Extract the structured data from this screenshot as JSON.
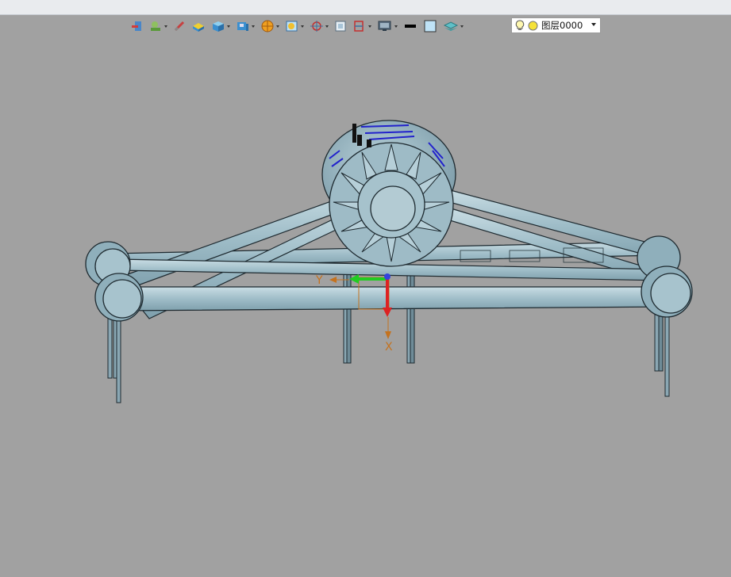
{
  "toolbar": {
    "buttons": [
      {
        "name": "snap-icon",
        "dropdown": false
      },
      {
        "name": "feature-icon",
        "dropdown": true
      },
      {
        "name": "pen-icon",
        "dropdown": false
      },
      {
        "name": "face-icon",
        "dropdown": false
      },
      {
        "name": "solid-icon",
        "dropdown": true
      },
      {
        "name": "view-cube-icon",
        "dropdown": true
      },
      {
        "name": "render-icon",
        "dropdown": true
      },
      {
        "name": "select-filter-icon",
        "dropdown": true
      },
      {
        "name": "target-icon",
        "dropdown": true
      },
      {
        "name": "frame-icon",
        "dropdown": false
      },
      {
        "name": "clip-icon",
        "dropdown": true
      },
      {
        "name": "monitor-icon",
        "dropdown": true
      },
      {
        "name": "line-color-icon",
        "dropdown": false
      },
      {
        "name": "fill-color-icon",
        "dropdown": false
      },
      {
        "name": "layer-stack-icon",
        "dropdown": true
      }
    ],
    "colors": {
      "line_color": "#000000",
      "fill_color": "#bfe3f7"
    }
  },
  "layer": {
    "name": "图层0000",
    "light_icon": "bulb-icon",
    "status_icon": "yellow-dot-icon"
  },
  "axes": {
    "x_label": "X",
    "y_label": "Y",
    "color": "#c4721e"
  },
  "viewport": {
    "background": "#a1a1a1",
    "model_color": "#9fbdc8"
  }
}
